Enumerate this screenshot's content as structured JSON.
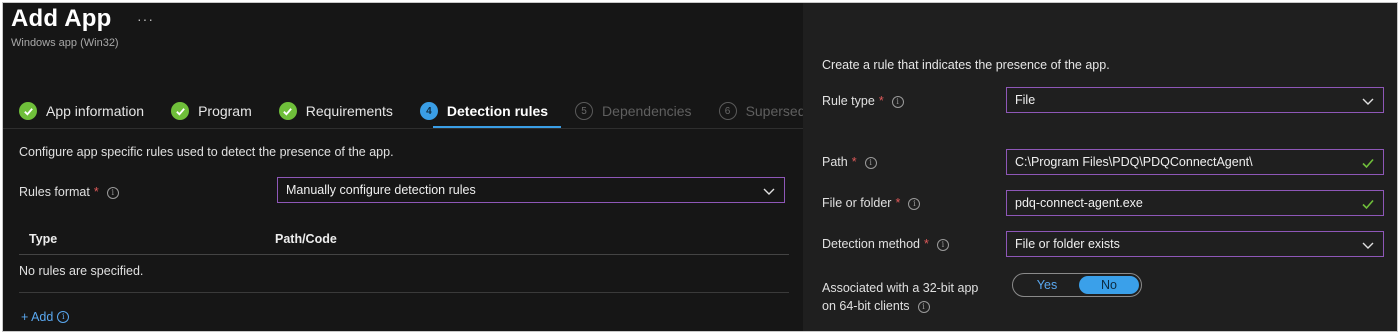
{
  "header": {
    "title": "Add App",
    "more_label": "···",
    "subtitle": "Windows app (Win32)"
  },
  "wizard": {
    "steps": [
      {
        "label": "App information",
        "state": "done",
        "marker": ""
      },
      {
        "label": "Program",
        "state": "done",
        "marker": ""
      },
      {
        "label": "Requirements",
        "state": "done",
        "marker": ""
      },
      {
        "label": "Detection rules",
        "state": "active",
        "marker": "4"
      },
      {
        "label": "Dependencies",
        "state": "future",
        "marker": "5"
      },
      {
        "label": "Supersedence",
        "state": "future",
        "marker": "6"
      }
    ]
  },
  "left": {
    "description": "Configure app specific rules used to detect the presence of the app.",
    "rules_format": {
      "label": "Rules format",
      "required": "*",
      "value": "Manually configure detection rules"
    },
    "table": {
      "columns": [
        "Type",
        "Path/Code"
      ],
      "empty_text": "No rules are specified."
    },
    "add_label": "+ Add"
  },
  "right": {
    "description": "Create a rule that indicates the presence of the app.",
    "rule_type": {
      "label": "Rule type",
      "required": "*",
      "value": "File"
    },
    "path": {
      "label": "Path",
      "required": "*",
      "value": "C:\\Program Files\\PDQ\\PDQConnectAgent\\"
    },
    "file_or_folder": {
      "label": "File or folder",
      "required": "*",
      "value": "pdq-connect-agent.exe"
    },
    "detection_method": {
      "label": "Detection method",
      "required": "*",
      "value": "File or folder exists"
    },
    "associated_32bit": {
      "label_line1": "Associated with a 32-bit app",
      "label_line2": "on 64-bit clients",
      "yes_label": "Yes",
      "no_label": "No",
      "selected": "No"
    }
  },
  "colors": {
    "accent_blue": "#3a9ee6",
    "success_green": "#6fbf3a",
    "field_border_purple": "#8e57b8",
    "required_red": "#e05a5a"
  }
}
